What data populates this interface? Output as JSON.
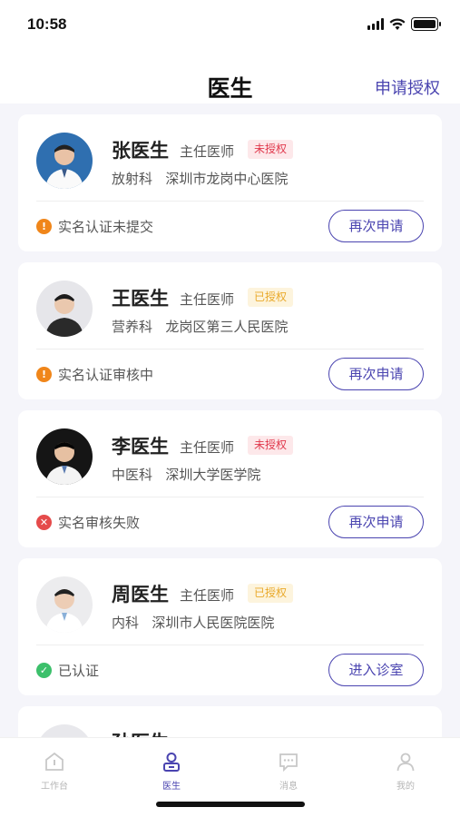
{
  "status_bar": {
    "time": "10:58"
  },
  "nav": {
    "title": "医生",
    "action": "申请授权"
  },
  "doctors": [
    {
      "name": "张医生",
      "title": "主任医师",
      "badge": "未授权",
      "badge_type": "unauth",
      "dept": "放射科",
      "hospital": "深圳市龙岗中心医院",
      "status": "实名认证未提交",
      "status_type": "warn",
      "button": "再次申请"
    },
    {
      "name": "王医生",
      "title": "主任医师",
      "badge": "已授权",
      "badge_type": "auth",
      "dept": "营养科",
      "hospital": "龙岗区第三人民医院",
      "status": "实名认证审核中",
      "status_type": "warn",
      "button": "再次申请"
    },
    {
      "name": "李医生",
      "title": "主任医师",
      "badge": "未授权",
      "badge_type": "unauth",
      "dept": "中医科",
      "hospital": "深圳大学医学院",
      "status": "实名审核失败",
      "status_type": "fail",
      "button": "再次申请"
    },
    {
      "name": "周医生",
      "title": "主任医师",
      "badge": "已授权",
      "badge_type": "auth",
      "dept": "内科",
      "hospital": "深圳市人民医院医院",
      "status": "已认证",
      "status_type": "ok",
      "button": "进入诊室"
    },
    {
      "name": "孙医生"
    }
  ],
  "tabs": [
    {
      "label": "工作台",
      "icon": "workbench-icon",
      "active": false
    },
    {
      "label": "医生",
      "icon": "doctor-icon",
      "active": true
    },
    {
      "label": "消息",
      "icon": "message-icon",
      "active": false
    },
    {
      "label": "我的",
      "icon": "profile-icon",
      "active": false
    }
  ],
  "colors": {
    "accent": "#4a44b0",
    "unauth": "#e0384c",
    "auth": "#e9a92a",
    "warn": "#f0861a",
    "fail": "#e54b4b",
    "ok": "#3cc06b"
  }
}
